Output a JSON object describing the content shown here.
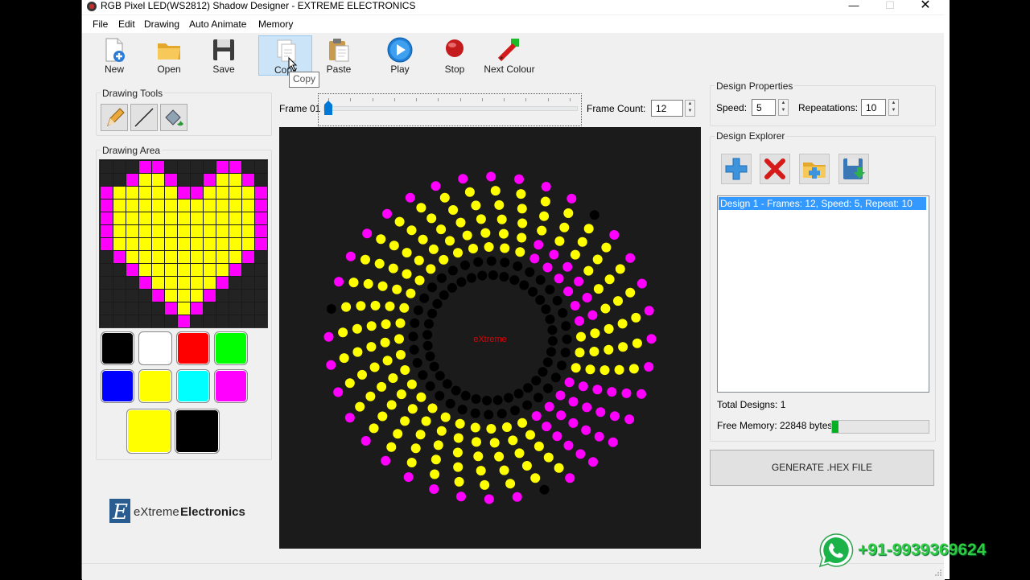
{
  "window": {
    "title": "RGB Pixel LED(WS2812) Shadow Designer - EXTREME ELECTRONICS"
  },
  "menu": [
    "File",
    "Edit",
    "Drawing",
    "Auto Animate",
    "Memory"
  ],
  "toolbar": {
    "new": "New",
    "open": "Open",
    "save": "Save",
    "copy": "Copy",
    "paste": "Paste",
    "play": "Play",
    "stop": "Stop",
    "next_colour": "Next Colour",
    "tooltip": "Copy"
  },
  "drawing_tools": {
    "title": "Drawing Tools"
  },
  "drawing_area": {
    "title": "Drawing Area",
    "grid_rows": [
      "KKKMMKKKKMMKK",
      "KKMYYMKKMYYMK",
      "MYYYYYMMYYYYM",
      "MYYYYYYYYYYYM",
      "MYYYYYYYYYYYM",
      "MYYYYYYYYYYYM",
      "MYYYYYYYYYYYM",
      "KMYYYYYYYYYMK",
      "KKMYYYYYYYMKK",
      "KKKMYYYYYMKKK",
      "KKKKMYYYMKKKK",
      "KKKKKMYMKKKKK",
      "KKKKKKMKKKKKK"
    ],
    "palette": [
      "#000000",
      "#ffffff",
      "#ff0000",
      "#00ff00",
      "#0000ff",
      "#ffff00",
      "#00ffff",
      "#ff00ff"
    ],
    "primary_color": "#ffff00",
    "secondary_color": "#000000"
  },
  "frame": {
    "label": "Frame 01",
    "count_label": "Frame Count:",
    "count_value": "12",
    "position": 0
  },
  "preview": {
    "center_text": "eXtreme",
    "spokes": 36,
    "leds_per_spoke": 8
  },
  "logo": {
    "text_light": "eXtreme",
    "text_bold": "Electronics"
  },
  "design_properties": {
    "title": "Design Properties",
    "speed_label": "Speed:",
    "speed_value": "5",
    "repeat_label": "Repeatations:",
    "repeat_value": "10"
  },
  "design_explorer": {
    "title": "Design Explorer",
    "items": [
      "Design 1 - Frames: 12, Speed: 5, Repeat: 10"
    ],
    "total_label": "Total Designs: 1",
    "free_memory_label": "Free Memory: 22848 bytes",
    "memory_fraction": 0.07
  },
  "generate_button": "GENERATE .HEX FILE",
  "overlay": {
    "phone": "+91-9939369624"
  },
  "colors": {
    "led_magenta": "#ff00ff",
    "led_yellow": "#ffff00",
    "led_off": "#000000",
    "selection": "#3399ff",
    "progress": "#06b025"
  }
}
